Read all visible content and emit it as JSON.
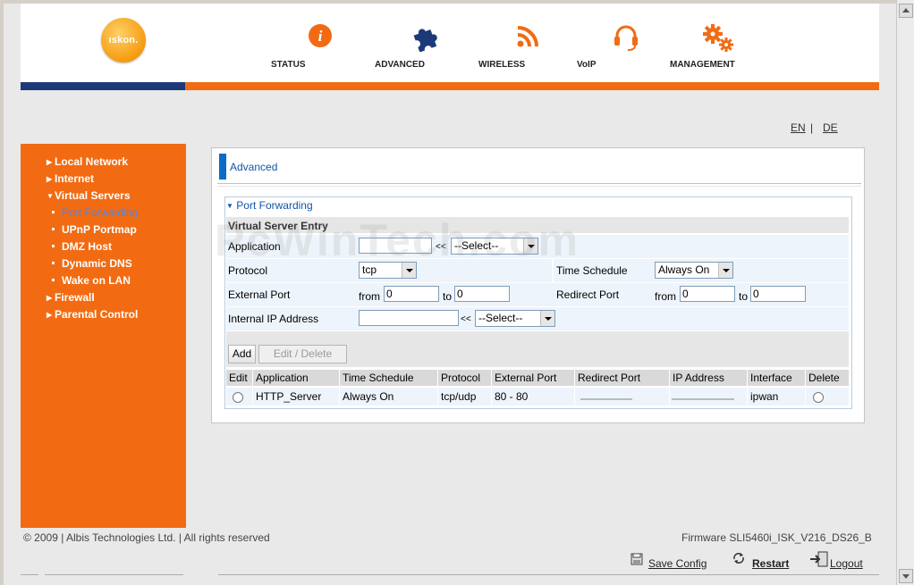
{
  "logo": {
    "text": "ıskon."
  },
  "nav": [
    {
      "label": "STATUS",
      "icon": "info-icon"
    },
    {
      "label": "ADVANCED",
      "icon": "puzzle-icon"
    },
    {
      "label": "WIRELESS",
      "icon": "wireless-icon"
    },
    {
      "label": "VoIP",
      "icon": "headset-icon"
    },
    {
      "label": "MANAGEMENT",
      "icon": "gears-icon"
    }
  ],
  "lang": {
    "en": "EN",
    "sep": "|",
    "de": "DE"
  },
  "sidebar": {
    "items": [
      {
        "label": "Local Network"
      },
      {
        "label": "Internet"
      },
      {
        "label": "Virtual Servers"
      },
      {
        "label": "Port Forwarding"
      },
      {
        "label": "UPnP Portmap"
      },
      {
        "label": "DMZ Host"
      },
      {
        "label": "Dynamic DNS"
      },
      {
        "label": "Wake on LAN"
      },
      {
        "label": "Firewall"
      },
      {
        "label": "Parental Control"
      }
    ]
  },
  "main": {
    "title": "Advanced",
    "section": "Port Forwarding",
    "entry_title": "Virtual Server Entry",
    "application_label": "Application",
    "application_value": "",
    "application_select": "--Select--",
    "protocol_label": "Protocol",
    "protocol_value": "tcp",
    "time_schedule_label": "Time Schedule",
    "time_schedule_value": "Always On",
    "external_port_label": "External Port",
    "redirect_port_label": "Redirect Port",
    "from_label": "from",
    "to_label": "to",
    "ext_from": "0",
    "ext_to": "0",
    "red_from": "0",
    "red_to": "0",
    "internal_ip_label": "Internal IP Address",
    "internal_ip_value": "",
    "internal_ip_select": "--Select--",
    "copy_arrows": "<<",
    "add_button": "Add",
    "edit_delete_button": "Edit / Delete"
  },
  "table": {
    "headers": [
      "Edit",
      "Application",
      "Time Schedule",
      "Protocol",
      "External Port",
      "Redirect Port",
      "IP Address",
      "Interface",
      "Delete"
    ],
    "rows": [
      {
        "application": "HTTP_Server",
        "schedule": "Always On",
        "protocol": "tcp/udp",
        "external_port": "80 - 80",
        "interface": "ipwan"
      }
    ]
  },
  "footer": {
    "copyright": "© 2009 | Albis Technologies Ltd. | All rights reserved",
    "firmware": "Firmware SLI5460i_ISK_V216_DS26_B",
    "save_config": "Save Config",
    "restart": "Restart",
    "logout": "Logout"
  },
  "watermark": "PcWinTech.com",
  "colors": {
    "orange": "#f26b12",
    "navy": "#1d3a78",
    "link_blue": "#1155aa"
  }
}
